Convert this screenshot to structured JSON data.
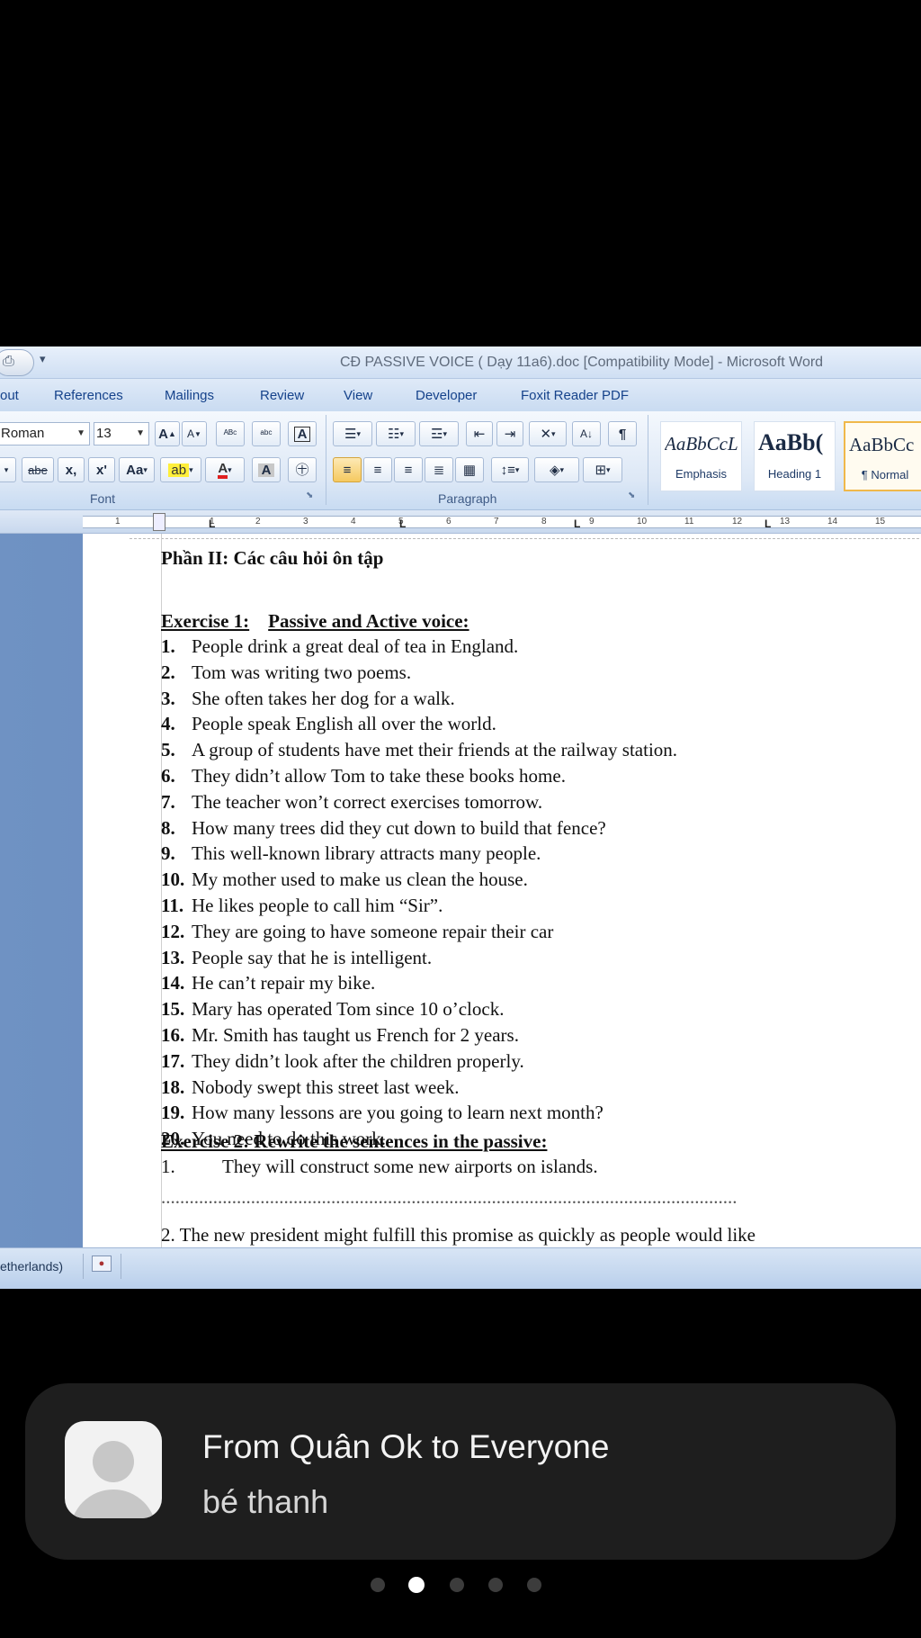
{
  "window": {
    "title": "CĐ PASSIVE VOICE ( Dạy 11a6).doc [Compatibility Mode] - Microsoft Word"
  },
  "ribbon": {
    "tabs": [
      "out",
      "References",
      "Mailings",
      "Review",
      "View",
      "Developer",
      "Foxit Reader PDF"
    ],
    "font_name": "Roman",
    "font_size": "13",
    "font_group_label": "Font",
    "paragraph_group_label": "Paragraph",
    "styles": [
      {
        "preview": "AaBbCcL",
        "name": "Emphasis"
      },
      {
        "preview": "AaBb(",
        "name": "Heading 1"
      },
      {
        "preview": "AaBbCc",
        "name": "¶ Normal"
      }
    ],
    "buttons": {
      "grow_font": "A",
      "shrink_font": "A",
      "clear_format": "A",
      "strikethrough": "abe",
      "subscript": "x,",
      "superscript": "x'",
      "change_case": "Aa",
      "font_color": "A",
      "char_shading": "A",
      "show_marks": "¶"
    }
  },
  "ruler": {
    "numbers": [
      "1",
      "1",
      "2",
      "3",
      "4",
      "5",
      "6",
      "7",
      "8",
      "9",
      "10",
      "11",
      "12",
      "13",
      "14",
      "15"
    ]
  },
  "document": {
    "section_title": "Phần II: Các câu hỏi ôn tập",
    "exercise1_label": "Exercise 1:",
    "exercise1_title": "Passive and Active voice:",
    "exercise1_items": [
      {
        "num": "1.",
        "text": "People drink a great deal of tea in England."
      },
      {
        "num": "2.",
        "text": "Tom was writing two poems."
      },
      {
        "num": "3.",
        "text": "She often takes her dog for a walk."
      },
      {
        "num": "4.",
        "text": "People speak English all over the world."
      },
      {
        "num": "5.",
        "text": "A group of students have met their friends at the railway station."
      },
      {
        "num": "6.",
        "text": "They didn’t allow Tom to take these books home."
      },
      {
        "num": "7.",
        "text": "The teacher won’t correct exercises tomorrow."
      },
      {
        "num": "8.",
        "text": "How many trees did they cut down to build that fence?"
      },
      {
        "num": "9.",
        "text": "This well-known library attracts many people."
      },
      {
        "num": "10.",
        "text": "My mother used to make us clean the house."
      },
      {
        "num": "11.",
        "text": "He likes people to call him “Sir”."
      },
      {
        "num": "12.",
        "text": "They are going to have someone repair their car"
      },
      {
        "num": "13.",
        "text": "People say that he is intelligent."
      },
      {
        "num": "14.",
        "text": "He can’t repair my bike."
      },
      {
        "num": "15.",
        "text": "Mary has operated Tom since 10 o’clock."
      },
      {
        "num": "16.",
        "text": "Mr. Smith has taught us French for 2 years."
      },
      {
        "num": "17.",
        "text": "They didn’t look after the children properly."
      },
      {
        "num": "18.",
        "text": "Nobody swept this street last week."
      },
      {
        "num": "19.",
        "text": "How many lessons are you going to learn next month?"
      },
      {
        "num": "20.",
        "text": "You need to do this work."
      }
    ],
    "exercise2_title": "Exercise 2: Rewrite the sentences in the passive:",
    "exercise2_item1_num": "1.",
    "exercise2_item1_text": "They will construct some new airports on islands.",
    "answer_line": "..........................................................................................................................",
    "exercise2_item2_partial": "2.          The new president might fulfill this promise as quickly as people would like"
  },
  "statusbar": {
    "language": "etherlands)"
  },
  "notification": {
    "title": "From Quân Ok to Everyone",
    "message": "bé thanh"
  },
  "pager": {
    "count": 5,
    "active_index": 1
  }
}
